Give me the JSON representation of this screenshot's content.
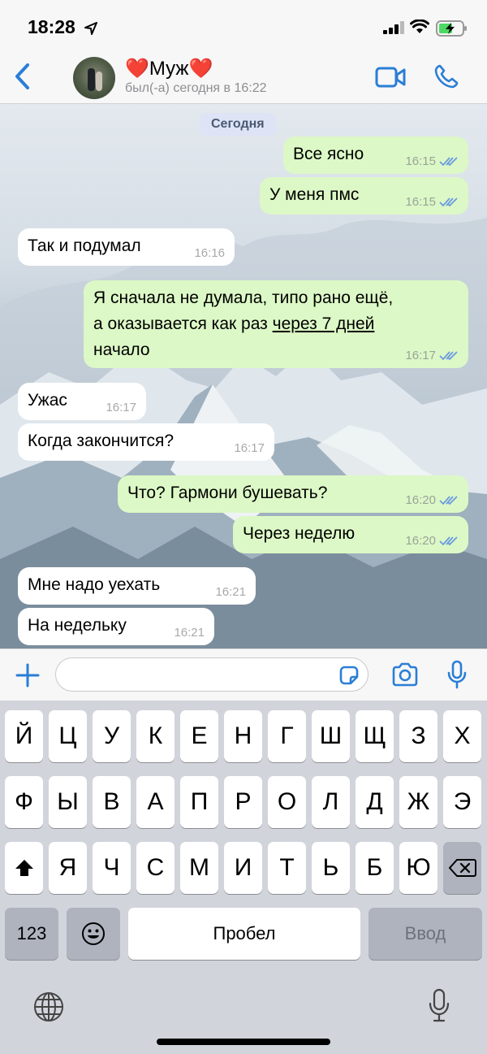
{
  "status_bar": {
    "time": "18:28"
  },
  "header": {
    "back_icon": "chevron-left-icon",
    "contact_heart_left": "❤️",
    "contact_name": "Муж",
    "contact_heart_right": "❤️",
    "contact_status": "был(-а) сегодня в 16:22",
    "accent_color": "#2a7ed6"
  },
  "chat": {
    "date_chip": "Сегодня",
    "messages": [
      {
        "dir": "out",
        "text": "Все ясно",
        "time": "16:15"
      },
      {
        "dir": "out",
        "text": "У меня пмс",
        "time": "16:15"
      },
      {
        "dir": "in",
        "text": "Так и подумал",
        "time": "16:16"
      },
      {
        "dir": "out",
        "lines": [
          "Я сначала не думала, типо рано ещё,",
          "а оказывается как раз ",
          "через 7 дней",
          "начало"
        ],
        "time": "16:17"
      },
      {
        "dir": "in",
        "text": "Ужас",
        "time": "16:17"
      },
      {
        "dir": "in",
        "text": "Когда закончится?",
        "time": "16:17"
      },
      {
        "dir": "out",
        "text": "Что? Гармони бушевать?",
        "time": "16:20"
      },
      {
        "dir": "out",
        "text": "Через неделю",
        "time": "16:20"
      },
      {
        "dir": "in",
        "text": "Мне надо уехать",
        "time": "16:21"
      },
      {
        "dir": "in",
        "text": "На недельку",
        "time": "16:21"
      }
    ],
    "outgoing_color": "#dcf8c6",
    "incoming_color": "#ffffff"
  },
  "input_bar": {
    "placeholder": ""
  },
  "keyboard": {
    "row1": [
      "Й",
      "Ц",
      "У",
      "К",
      "Е",
      "Н",
      "Г",
      "Ш",
      "Щ",
      "З",
      "Х"
    ],
    "row2": [
      "Ф",
      "Ы",
      "В",
      "А",
      "П",
      "Р",
      "О",
      "Л",
      "Д",
      "Ж",
      "Э"
    ],
    "row3": [
      "Я",
      "Ч",
      "С",
      "М",
      "И",
      "Т",
      "Ь",
      "Б",
      "Ю"
    ],
    "numbers_key": "123",
    "space_key": "Пробел",
    "return_key": "Ввод"
  }
}
